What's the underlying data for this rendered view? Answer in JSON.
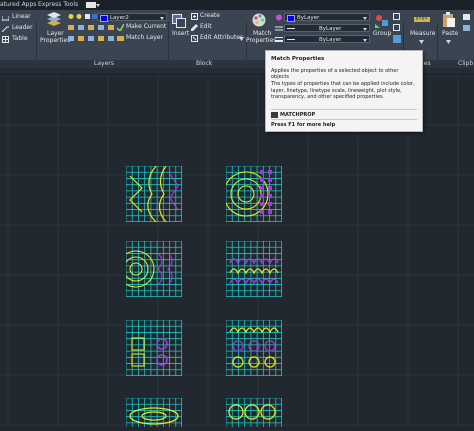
{
  "tabs": {
    "featured_apps": "atured Apps",
    "express_tools": "Express Tools"
  },
  "annotation": {
    "linear": "Linear",
    "leader": "Leader",
    "table": "Table"
  },
  "layers": {
    "layer_properties_line1": "Layer",
    "layer_properties_line2": "Properties",
    "current_layer": "Layer2",
    "make_current": "Make Current",
    "match_layer": "Match Layer"
  },
  "block": {
    "insert": "Insert",
    "create": "Create",
    "edit": "Edit",
    "edit_attributes": "Edit Attributes"
  },
  "properties": {
    "match_properties_line1": "Match",
    "match_properties_line2": "Properties",
    "color": "ByLayer",
    "linetype": "ByLayer",
    "lineweight": "ByLayer"
  },
  "groups": {
    "group": "Group"
  },
  "utilities": {
    "measure": "Measure"
  },
  "clipboard": {
    "paste": "Paste"
  },
  "panels": {
    "layers": "Layers",
    "block": "Block",
    "properties_partial": "ies",
    "clipboard_partial": "Clipb"
  },
  "tooltip": {
    "title": "Match Properties",
    "subtitle": "Applies the properties of a selected object to other objects",
    "body": "The types of properties that can be applied include color, layer, linetype, linetype scale, lineweight, plot style, transparency, and other specified properties.",
    "command": "MATCHPROP",
    "help": "Press F1 for more help"
  },
  "colors": {
    "grid": "#1fc4c4",
    "yellow": "#e6e61a",
    "magenta": "#9b3fd6",
    "canvas": "#212830"
  }
}
